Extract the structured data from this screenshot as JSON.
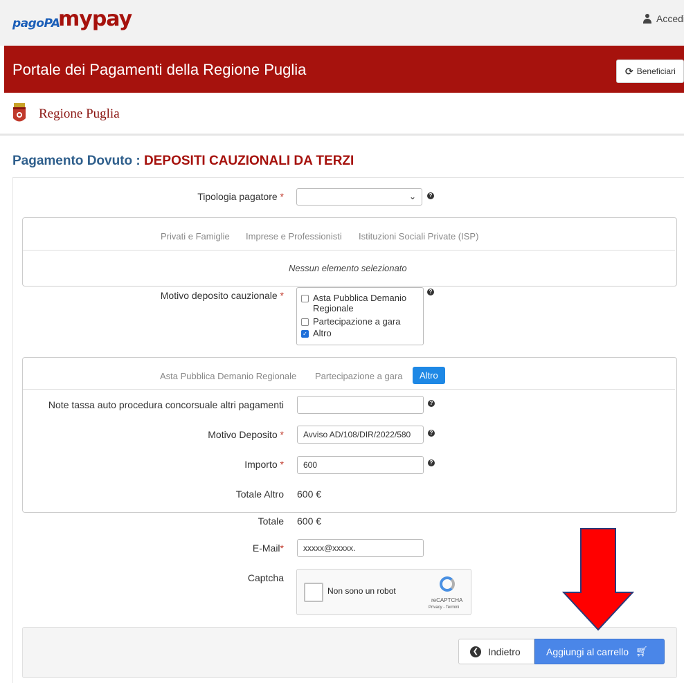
{
  "header": {
    "pagopa_logo": "pagoPA",
    "mypay_logo": "mypay",
    "login_label": "Accedi",
    "icons": {
      "user": "user-icon"
    }
  },
  "banner": {
    "title": "Portale dei Pagamenti della Regione Puglia",
    "beneficiari_label": "Beneficiari",
    "icon": "refresh-icon",
    "color": "#a6120d"
  },
  "entity": {
    "name": "Regione Puglia",
    "icon": "crest-icon"
  },
  "page_title": {
    "prefix": "Pagamento Dovuto : ",
    "subject": "DEPOSITI CAUZIONALI DA TERZI"
  },
  "form": {
    "tipologia_label": "Tipologia pagatore",
    "tipologia_value": "",
    "tipologia_tabs": [
      "Privati e Famiglie",
      "Imprese e Professionisti",
      "Istituzioni Sociali Private (ISP)"
    ],
    "nessun_elemento": "Nessun elemento selezionato",
    "motivo_label": "Motivo deposito cauzionale",
    "motivo_options": [
      {
        "label": "Asta Pubblica Demanio Regionale",
        "checked": false
      },
      {
        "label": "Partecipazione a gara",
        "checked": false
      },
      {
        "label": "Altro",
        "checked": true
      }
    ],
    "motivo_tabs": [
      "Asta Pubblica Demanio Regionale",
      "Partecipazione a gara",
      "Altro"
    ],
    "active_tab": "Altro",
    "note_label": "Note tassa auto procedura concorsuale altri pagamenti",
    "note_value": "",
    "motivo_deposito_label": "Motivo Deposito",
    "motivo_deposito_value": "Avviso AD/108/DIR/2022/580",
    "importo_label": "Importo",
    "importo_value": "600",
    "totale_altro_label": "Totale Altro",
    "totale_altro_value": "600 €",
    "totale_label": "Totale",
    "totale_value": "600 €",
    "email_label": "E-Mail",
    "email_value": "xxxxx@xxxxx.",
    "captcha_label": "Captcha",
    "captcha_text": "Non sono un robot",
    "captcha_brand": "reCAPTCHA",
    "captcha_links": "Privacy - Termini",
    "required_mark": "*",
    "help_glyph": "?"
  },
  "footer": {
    "back_label": "Indietro",
    "cart_label": "Aggiungi al carrello",
    "cart_color": "#4a86e8"
  },
  "annotation": {
    "arrow_color": "#ff0000"
  }
}
